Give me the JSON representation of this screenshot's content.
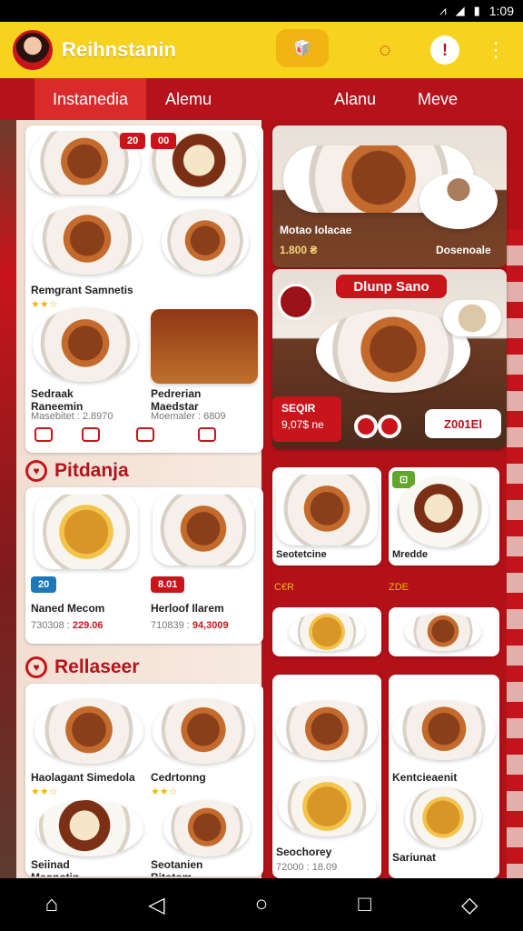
{
  "status": {
    "time": "1:09"
  },
  "app": {
    "title": "Reihnstanin",
    "colors": {
      "brand": "#f7d21f",
      "primary": "#b5121b",
      "accent": "#c8151b"
    }
  },
  "icons": {
    "status": [
      "vibrate-icon",
      "signal-icon",
      "battery-icon"
    ],
    "top": [
      "food-icon",
      "user-icon",
      "alert-icon",
      "more-icon"
    ]
  },
  "nav": {
    "tabs": [
      "Instanedia",
      "Alemu",
      "Alanu",
      "Meve"
    ]
  },
  "left": {
    "top_card": {
      "badge_1": "20",
      "badge_2": "00",
      "row_title": "Remgrant Samnetis",
      "bottom_left_title": "Sedraak\nRaneemin",
      "bottom_left_price": "Masebitet : 2.8970",
      "bottom_right_title": "Pedrerian\nMaedstar",
      "bottom_right_price": "Moemaler : 6809"
    },
    "section_1": {
      "title": "Pitdanja",
      "items": [
        {
          "name": "Naned Mecom",
          "price": "730308 :",
          "value": "229.06",
          "chip": "20"
        },
        {
          "name": "Herloof Ilarem",
          "price": "710839 :",
          "value": "94,3009",
          "chip": "8.01"
        }
      ]
    },
    "section_2": {
      "title": "Rellaseer",
      "items": [
        {
          "name": "Haolagant Simedola",
          "price": "",
          "value": ""
        },
        {
          "name": "Cedrtonng",
          "price": "",
          "value": ""
        },
        {
          "name": "Seiinad\nMeonotin",
          "price": "",
          "value": ""
        },
        {
          "name": "Seotanien\nBitotom",
          "price": "",
          "value": ""
        }
      ]
    }
  },
  "right": {
    "banner_1": {
      "name": "Motao Iolacae",
      "price": "1.800 ₴",
      "tag": "Dosenoale"
    },
    "banner_2": {
      "title": "Dlunp Sano",
      "left_text_1": "SEQIR",
      "left_text_2": "9,07$ ne",
      "button": "Z001El"
    },
    "grid": [
      {
        "name": "Seotetcine",
        "sub": "C€R"
      },
      {
        "name": "Mredde",
        "sub": "ZDE"
      },
      {
        "name": "Seochorey",
        "sub": "72000 : 18.09"
      },
      {
        "name": "Kentcieaenit",
        "sub": ""
      },
      {
        "name": "Sariunat",
        "sub": ""
      }
    ]
  },
  "bottom_nav": [
    "home-icon",
    "back-icon",
    "home-circle-icon",
    "recent-icon",
    "assistant-icon"
  ]
}
